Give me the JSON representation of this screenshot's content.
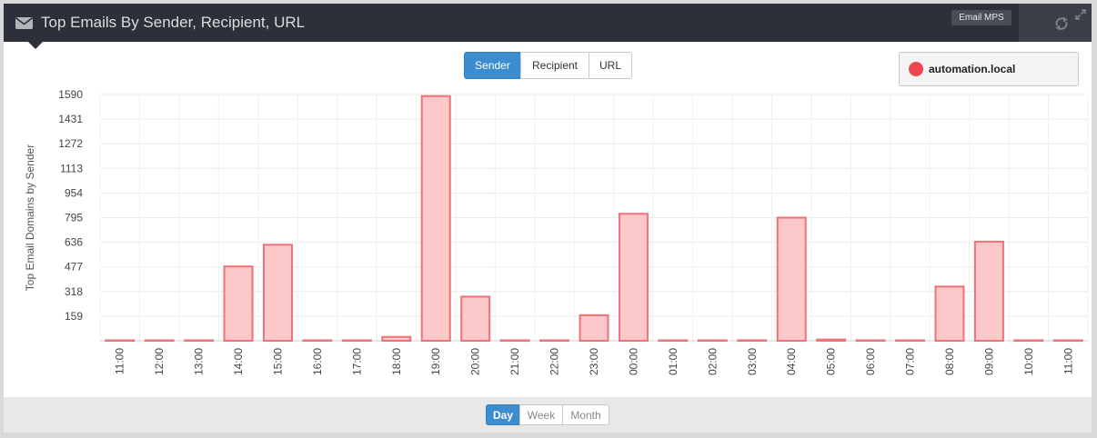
{
  "header": {
    "title": "Top Emails By Sender, Recipient, URL",
    "badge": "Email MPS"
  },
  "modes": [
    {
      "label": "Sender",
      "active": true
    },
    {
      "label": "Recipient",
      "active": false
    },
    {
      "label": "URL",
      "active": false
    }
  ],
  "ranges": [
    {
      "label": "Day",
      "active": true
    },
    {
      "label": "Week",
      "active": false
    },
    {
      "label": "Month",
      "active": false
    }
  ],
  "legend": {
    "label": "automation.local",
    "color": "#f0454d"
  },
  "chart_data": {
    "type": "bar",
    "title": "",
    "xlabel": "",
    "ylabel": "Top Email Domains by Sender",
    "ylim": [
      0,
      1590
    ],
    "yticks": [
      1590,
      1431,
      1272,
      1113,
      954,
      795,
      636,
      477,
      318,
      159
    ],
    "categories": [
      "11:00",
      "12:00",
      "13:00",
      "14:00",
      "15:00",
      "16:00",
      "17:00",
      "18:00",
      "19:00",
      "20:00",
      "21:00",
      "22:00",
      "23:00",
      "00:00",
      "01:00",
      "02:00",
      "03:00",
      "04:00",
      "05:00",
      "06:00",
      "07:00",
      "08:00",
      "09:00",
      "10:00",
      "11:00"
    ],
    "series": [
      {
        "name": "automation.local",
        "values": [
          0,
          0,
          2,
          480,
          620,
          0,
          0,
          25,
          1580,
          285,
          0,
          2,
          165,
          820,
          0,
          0,
          3,
          795,
          8,
          0,
          0,
          350,
          640,
          0,
          0
        ]
      }
    ],
    "bar_fill": "#fcc8ca",
    "bar_stroke": "#ef7278",
    "grid": true
  }
}
